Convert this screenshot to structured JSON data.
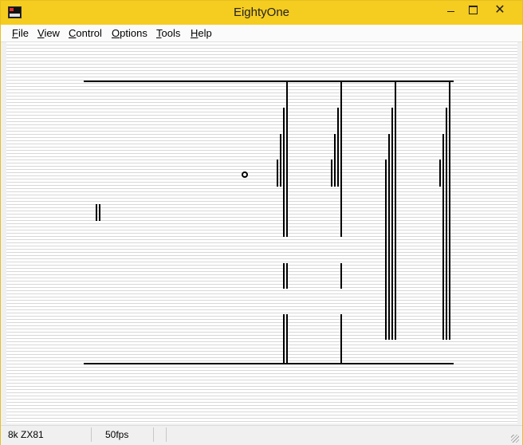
{
  "window": {
    "title": "EightyOne"
  },
  "menu": {
    "items": [
      {
        "id": "file",
        "label": "File"
      },
      {
        "id": "view",
        "label": "View"
      },
      {
        "id": "control",
        "label": "Control"
      },
      {
        "id": "options",
        "label": "Options"
      },
      {
        "id": "tools",
        "label": "Tools"
      },
      {
        "id": "help",
        "label": "Help"
      }
    ]
  },
  "caption": {
    "close_glyph": "✕"
  },
  "status": {
    "machine": "8k ZX81",
    "fps": "50fps"
  },
  "colors": {
    "titlebar": "#f5cc20",
    "screen_ink": "#000000",
    "screen_paper": "#ffffff"
  }
}
